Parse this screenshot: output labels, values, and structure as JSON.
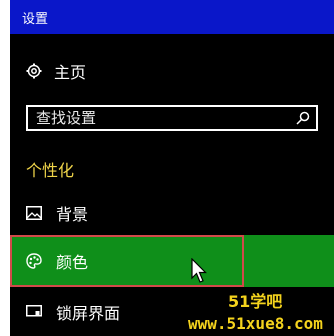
{
  "window": {
    "title": "设置"
  },
  "nav": {
    "home": "主页",
    "search_placeholder": "查找设置",
    "section": "个性化",
    "items": [
      {
        "label": "背景"
      },
      {
        "label": "颜色"
      },
      {
        "label": "锁屏界面"
      }
    ]
  },
  "watermark": {
    "line1": "51学吧",
    "line2": "www.51xue8.com"
  },
  "colors": {
    "title_bar": "#0a17c9",
    "selected_item": "#0f8f1a",
    "section_heading": "#f0d54a",
    "highlight_frame": "#d24a4a",
    "watermark": "#f4d31d"
  }
}
